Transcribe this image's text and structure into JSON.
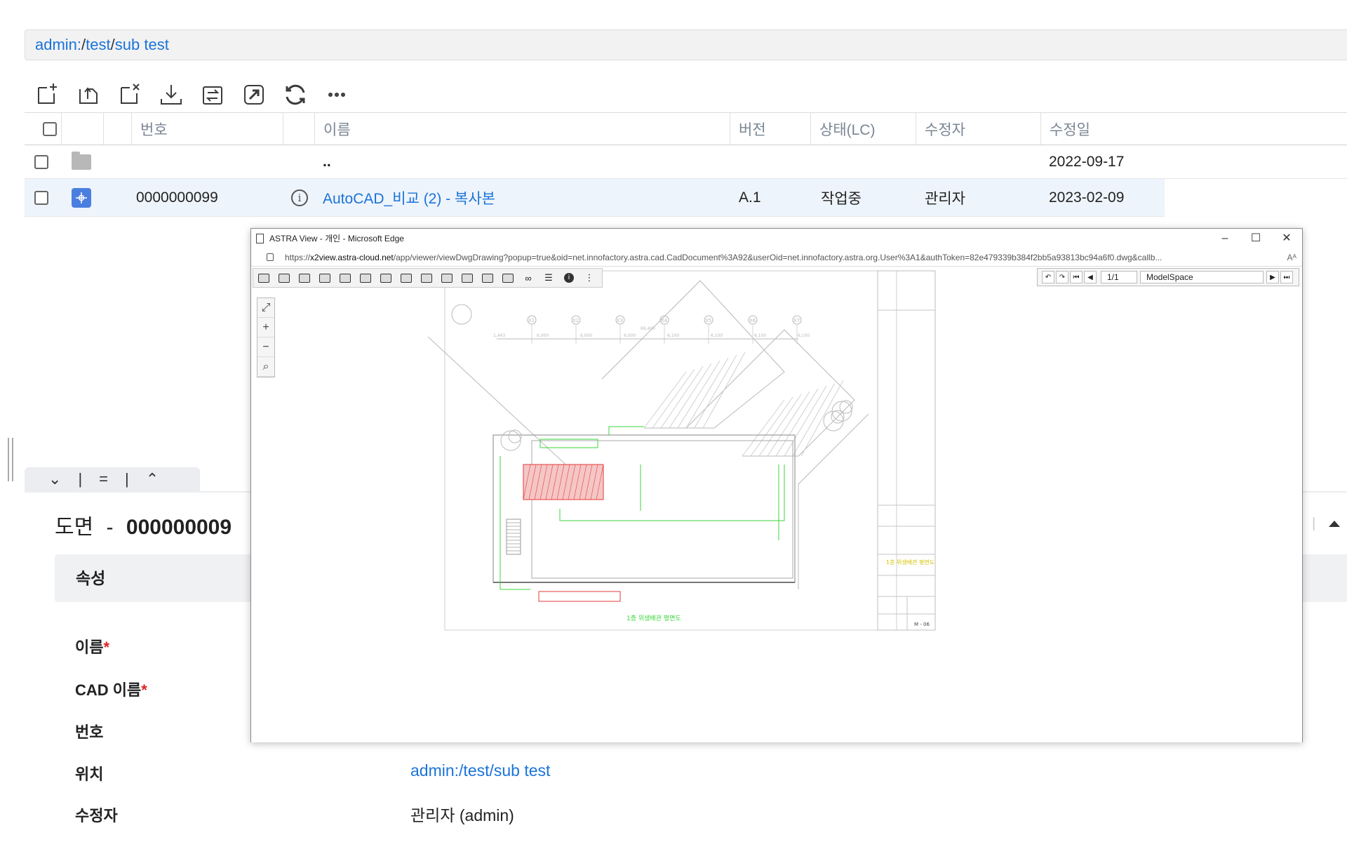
{
  "breadcrumb": {
    "root": "admin:",
    "sep1": "/",
    "folder": "test",
    "sep2": "/",
    "sub": "sub test"
  },
  "toolbar": [
    "add-file-icon",
    "upload-icon",
    "delete-icon",
    "download-icon",
    "replace-icon",
    "open-external-icon",
    "refresh-icon",
    "more-icon"
  ],
  "table": {
    "headers": {
      "number": "번호",
      "name": "이름",
      "version": "버전",
      "state": "상태(LC)",
      "modifier": "수정자",
      "modified": "수정일"
    },
    "rows": [
      {
        "name": "..",
        "modified": "2022-09-17"
      },
      {
        "number": "0000000099",
        "name": "AutoCAD_비교 (2) - 복사본",
        "version": "A.1",
        "state": "작업중",
        "modifier": "관리자",
        "modified": "2023-02-09"
      }
    ]
  },
  "detail": {
    "collapse_icons": [
      "⌄",
      "|",
      "=",
      "|",
      "⌃"
    ],
    "title_prefix": "도면",
    "title_dash": "-",
    "title_number": "000000009",
    "attr_header": "속성",
    "fields": {
      "name_label": "이름",
      "cad_name_label": "CAD 이름",
      "number_label": "번호",
      "location_label": "위치",
      "location_value": "admin:/test/sub test",
      "modifier_label": "수정자",
      "modifier_value": "관리자 (admin)",
      "required_mark": "*"
    }
  },
  "popup": {
    "window_title": "ASTRA View - 개인 - Microsoft Edge",
    "url_prefix": "https://",
    "url_host": "x2view.astra-cloud.net",
    "url_rest": "/app/viewer/viewDwgDrawing?popup=true&oid=net.innofactory.astra.cad.CadDocument%3A92&userOid=net.innofactory.astra.org.User%3A1&authToken=82e479339b384f2bb5a93813bc94a6f0.dwg&callb...",
    "read_aloud": "Aᴬ",
    "min_btn": "–",
    "max_btn": "☐",
    "close_btn": "✕",
    "page": "1/1",
    "space": "ModelSpace",
    "zoom_tools": [
      "⤢",
      "+",
      "−",
      "⌕"
    ]
  },
  "drawing_text": {
    "floor_plan_title": "1층 위생배관 평면도",
    "grid_labels": [
      "X1",
      "X2",
      "X3",
      "X4",
      "X5",
      "X6",
      "X7"
    ],
    "dims": [
      "1,443",
      "6,000",
      "6,000",
      "6,000",
      "6,100",
      "6,100",
      "6,100",
      "6,100"
    ],
    "total_dim": "69,400",
    "titleblock_title": "1층 위생배관 평면도",
    "sheet_no": "M - 06"
  },
  "colors": {
    "accent": "#1a73d9",
    "required": "#e02020",
    "cad_icon": "#4a7fe0",
    "drawing_line": "#b8b8b8",
    "drawing_green": "#3bd63b",
    "drawing_red": "#e53a3a"
  }
}
